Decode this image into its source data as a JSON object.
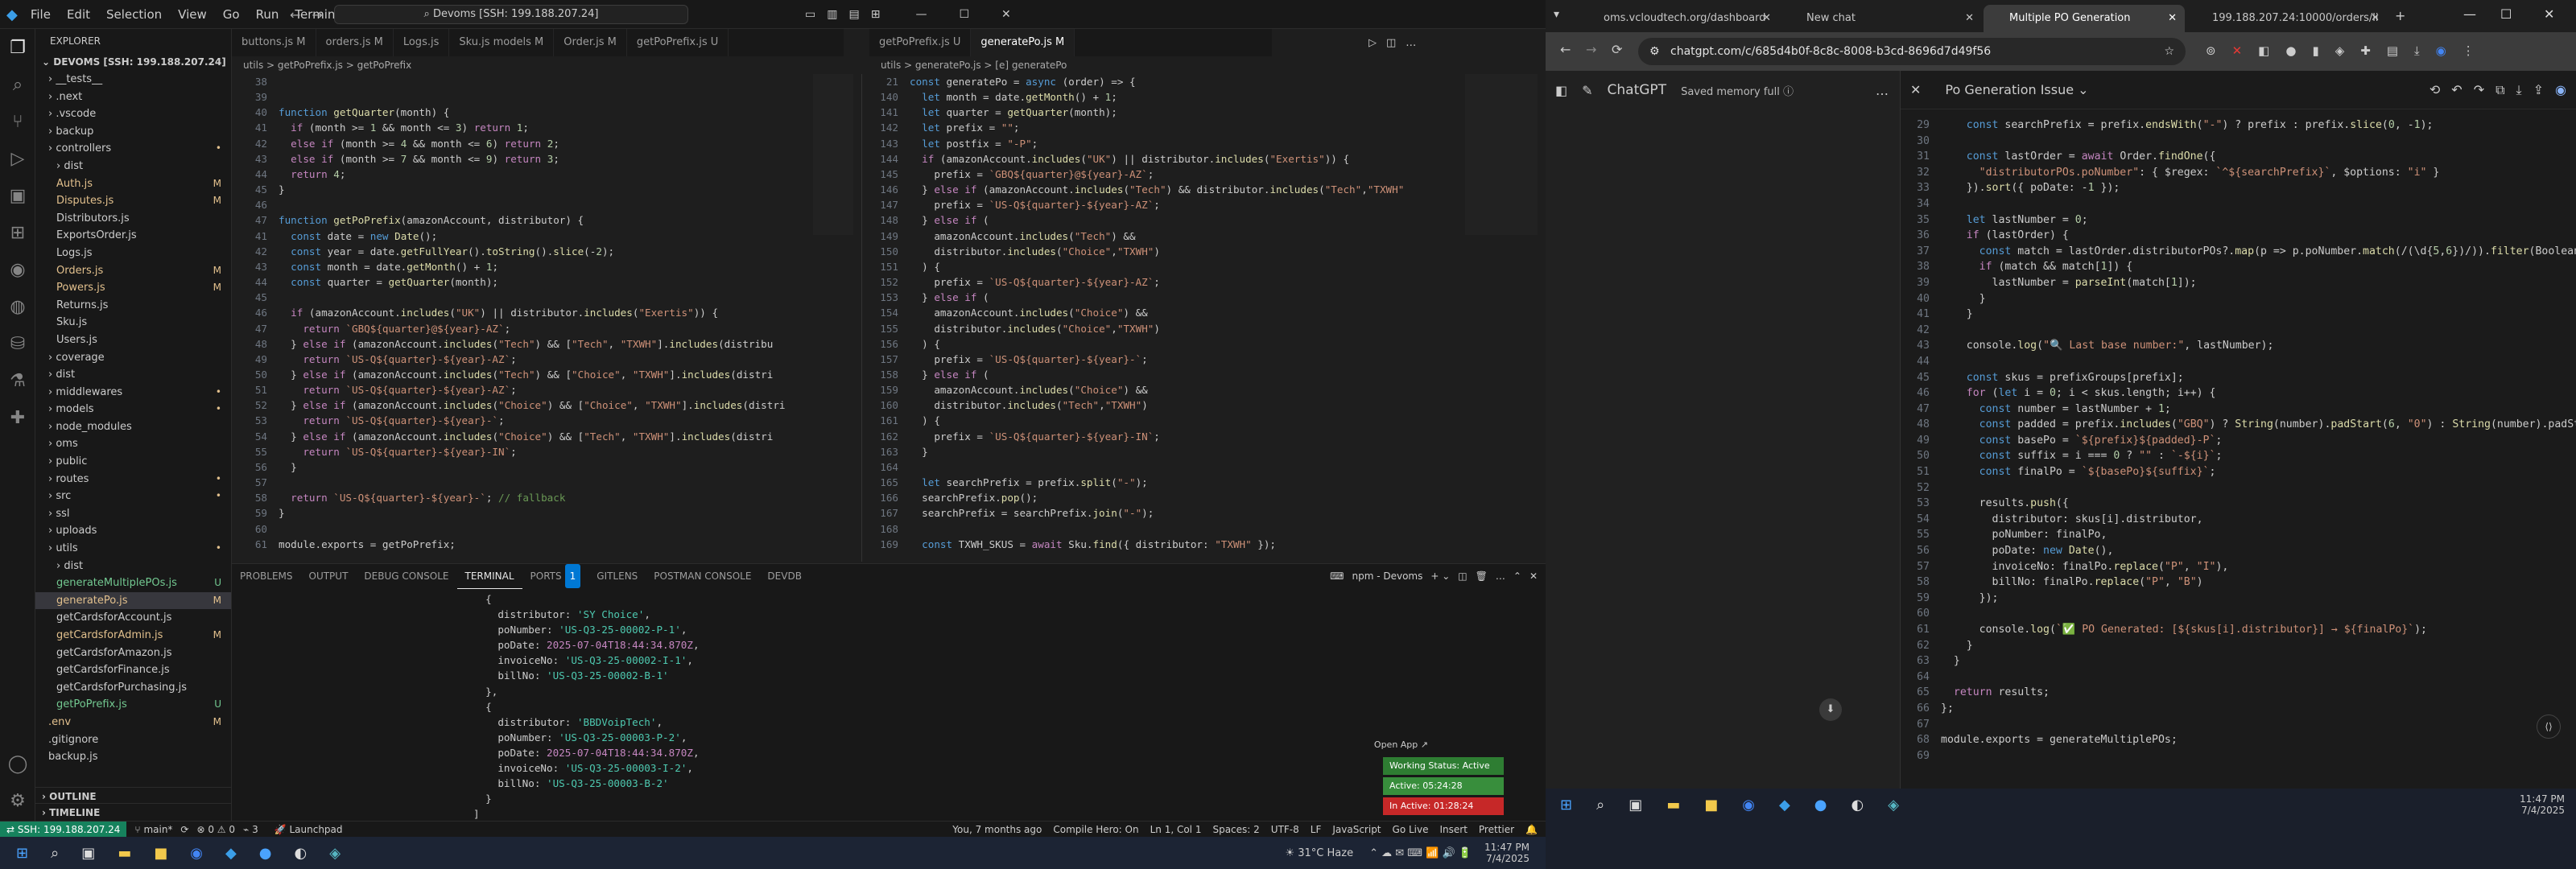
{
  "vscode": {
    "menu": [
      "File",
      "Edit",
      "Selection",
      "View",
      "Go",
      "Run",
      "Terminal",
      "Help"
    ],
    "search": "Devoms [SSH: 199.188.207.24]",
    "explorer_title": "EXPLORER",
    "root": "DEVOMS [SSH: 199.188.207.24]",
    "tree": [
      {
        "n": "__tests__",
        "i": 1,
        "s": ""
      },
      {
        "n": ".next",
        "i": 1,
        "s": ""
      },
      {
        "n": ".vscode",
        "i": 1,
        "s": ""
      },
      {
        "n": "backup",
        "i": 1,
        "s": ""
      },
      {
        "n": "controllers",
        "i": 1,
        "s": "•"
      },
      {
        "n": "dist",
        "i": 2,
        "s": ""
      },
      {
        "n": "Auth.js",
        "i": 2,
        "s": "M"
      },
      {
        "n": "Disputes.js",
        "i": 2,
        "s": "M"
      },
      {
        "n": "Distributors.js",
        "i": 2,
        "s": ""
      },
      {
        "n": "ExportsOrder.js",
        "i": 2,
        "s": ""
      },
      {
        "n": "Logs.js",
        "i": 2,
        "s": ""
      },
      {
        "n": "Orders.js",
        "i": 2,
        "s": "M"
      },
      {
        "n": "Powers.js",
        "i": 2,
        "s": "M"
      },
      {
        "n": "Returns.js",
        "i": 2,
        "s": ""
      },
      {
        "n": "Sku.js",
        "i": 2,
        "s": ""
      },
      {
        "n": "Users.js",
        "i": 2,
        "s": ""
      },
      {
        "n": "coverage",
        "i": 1,
        "s": ""
      },
      {
        "n": "dist",
        "i": 1,
        "s": ""
      },
      {
        "n": "middlewares",
        "i": 1,
        "s": "•"
      },
      {
        "n": "models",
        "i": 1,
        "s": "•"
      },
      {
        "n": "node_modules",
        "i": 1,
        "s": ""
      },
      {
        "n": "oms",
        "i": 1,
        "s": ""
      },
      {
        "n": "public",
        "i": 1,
        "s": ""
      },
      {
        "n": "routes",
        "i": 1,
        "s": "•"
      },
      {
        "n": "src",
        "i": 1,
        "s": "•"
      },
      {
        "n": "ssl",
        "i": 1,
        "s": ""
      },
      {
        "n": "uploads",
        "i": 1,
        "s": ""
      },
      {
        "n": "utils",
        "i": 1,
        "s": "•"
      },
      {
        "n": "dist",
        "i": 2,
        "s": ""
      },
      {
        "n": "generateMultiplePOs.js",
        "i": 2,
        "s": "U"
      },
      {
        "n": "generatePo.js",
        "i": 2,
        "s": "M"
      },
      {
        "n": "getCardsforAccount.js",
        "i": 2,
        "s": ""
      },
      {
        "n": "getCardsforAdmin.js",
        "i": 2,
        "s": "M"
      },
      {
        "n": "getCardsforAmazon.js",
        "i": 2,
        "s": ""
      },
      {
        "n": "getCardsforFinance.js",
        "i": 2,
        "s": ""
      },
      {
        "n": "getCardsforPurchasing.js",
        "i": 2,
        "s": ""
      },
      {
        "n": "getPoPrefix.js",
        "i": 2,
        "s": "U"
      },
      {
        "n": ".env",
        "i": 1,
        "s": "M"
      },
      {
        "n": ".gitignore",
        "i": 1,
        "s": ""
      },
      {
        "n": "backup.js",
        "i": 1,
        "s": ""
      }
    ],
    "outline": "OUTLINE",
    "timeline": "TIMELINE",
    "tabs_left": [
      "buttons.js M",
      "orders.js M",
      "Logs.js",
      "Sku.js models M",
      "Order.js M",
      "getPoPrefix.js U"
    ],
    "tabs_right": [
      "getPoPrefix.js U",
      "generatePo.js M"
    ],
    "crumb_left": "utils > getPoPrefix.js > getPoPrefix",
    "crumb_right": "utils > generatePo.js > [e] generatePo",
    "left_code": [
      [
        "38",
        ""
      ],
      [
        "39",
        ""
      ],
      [
        "40",
        "function getQuarter(month) {"
      ],
      [
        "41",
        "  if (month >= 1 && month <= 3) return 1;"
      ],
      [
        "42",
        "  else if (month >= 4 && month <= 6) return 2;"
      ],
      [
        "43",
        "  else if (month >= 7 && month <= 9) return 3;"
      ],
      [
        "44",
        "  return 4;"
      ],
      [
        "45",
        "}"
      ],
      [
        "46",
        ""
      ],
      [
        "47",
        "function getPoPrefix(amazonAccount, distributor) {"
      ],
      [
        "41",
        "  const date = new Date();"
      ],
      [
        "42",
        "  const year = date.getFullYear().toString().slice(-2);"
      ],
      [
        "43",
        "  const month = date.getMonth() + 1;"
      ],
      [
        "44",
        "  const quarter = getQuarter(month);"
      ],
      [
        "45",
        ""
      ],
      [
        "46",
        "  if (amazonAccount.includes(\"UK\") || distributor.includes(\"Exertis\")) {"
      ],
      [
        "47",
        "    return `GBQ${quarter}@${year}-AZ`;"
      ],
      [
        "48",
        "  } else if (amazonAccount.includes(\"Tech\") && [\"Tech\", \"TXWH\"].includes(distribu"
      ],
      [
        "49",
        "    return `US-Q${quarter}-${year}-AZ`;"
      ],
      [
        "50",
        "  } else if (amazonAccount.includes(\"Tech\") && [\"Choice\", \"TXWH\"].includes(distri"
      ],
      [
        "51",
        "    return `US-Q${quarter}-${year}-AZ`;"
      ],
      [
        "52",
        "  } else if (amazonAccount.includes(\"Choice\") && [\"Choice\", \"TXWH\"].includes(distri"
      ],
      [
        "53",
        "    return `US-Q${quarter}-${year}-`;"
      ],
      [
        "54",
        "  } else if (amazonAccount.includes(\"Choice\") && [\"Tech\", \"TXWH\"].includes(distri"
      ],
      [
        "55",
        "    return `US-Q${quarter}-${year}-IN`;"
      ],
      [
        "56",
        "  }"
      ],
      [
        "57",
        ""
      ],
      [
        "58",
        "  return `US-Q${quarter}-${year}-`; // fallback"
      ],
      [
        "59",
        "}"
      ],
      [
        "60",
        ""
      ],
      [
        "61",
        "module.exports = getPoPrefix;"
      ]
    ],
    "right_code": [
      [
        "21",
        "const generatePo = async (order) => {"
      ],
      [
        "140",
        "  let month = date.getMonth() + 1;"
      ],
      [
        "141",
        "  let quarter = getQuarter(month);"
      ],
      [
        "142",
        "  let prefix = \"\";"
      ],
      [
        "143",
        "  let postfix = \"-P\";"
      ],
      [
        "144",
        "  if (amazonAccount.includes(\"UK\") || distributor.includes(\"Exertis\")) {"
      ],
      [
        "145",
        "    prefix = `GBQ${quarter}@${year}-AZ`;"
      ],
      [
        "146",
        "  } else if (amazonAccount.includes(\"Tech\") && distributor.includes(\"Tech\",\"TXWH\""
      ],
      [
        "147",
        "    prefix = `US-Q${quarter}-${year}-AZ`;"
      ],
      [
        "148",
        "  } else if ("
      ],
      [
        "149",
        "    amazonAccount.includes(\"Tech\") &&"
      ],
      [
        "150",
        "    distributor.includes(\"Choice\",\"TXWH\")"
      ],
      [
        "151",
        "  ) {"
      ],
      [
        "152",
        "    prefix = `US-Q${quarter}-${year}-AZ`;"
      ],
      [
        "153",
        "  } else if ("
      ],
      [
        "154",
        "    amazonAccount.includes(\"Choice\") &&"
      ],
      [
        "155",
        "    distributor.includes(\"Choice\",\"TXWH\")"
      ],
      [
        "156",
        "  ) {"
      ],
      [
        "157",
        "    prefix = `US-Q${quarter}-${year}-`;"
      ],
      [
        "158",
        "  } else if ("
      ],
      [
        "159",
        "    amazonAccount.includes(\"Choice\") &&"
      ],
      [
        "160",
        "    distributor.includes(\"Tech\",\"TXWH\")"
      ],
      [
        "161",
        "  ) {"
      ],
      [
        "162",
        "    prefix = `US-Q${quarter}-${year}-IN`;"
      ],
      [
        "163",
        "  }"
      ],
      [
        "164",
        ""
      ],
      [
        "165",
        "  let searchPrefix = prefix.split(\"-\");"
      ],
      [
        "166",
        "  searchPrefix.pop();"
      ],
      [
        "167",
        "  searchPrefix = searchPrefix.join(\"-\");"
      ],
      [
        "168",
        ""
      ],
      [
        "169",
        "  const TXWH_SKUS = await Sku.find({ distributor: \"TXWH\" });"
      ]
    ],
    "panel_tabs": [
      "PROBLEMS",
      "OUTPUT",
      "DEBUG CONSOLE",
      "TERMINAL",
      "PORTS",
      "GITLENS",
      "POSTMAN CONSOLE",
      "DEVDB"
    ],
    "ports_count": "1",
    "terminal_name": "npm - Devoms",
    "terminal": [
      "  {",
      "    distributor: 'SY Choice',",
      "    poNumber: 'US-Q3-25-00002-P-1',",
      "    poDate: 2025-07-04T18:44:34.870Z,",
      "    invoiceNo: 'US-Q3-25-00002-I-1',",
      "    billNo: 'US-Q3-25-00002-B-1'",
      "  },",
      "  {",
      "    distributor: 'BBDVoipTech',",
      "    poNumber: 'US-Q3-25-00003-P-2',",
      "    poDate: 2025-07-04T18:44:34.870Z,",
      "    invoiceNo: 'US-Q3-25-00003-I-2',",
      "    billNo: 'US-Q3-25-00003-B-2'",
      "  }",
      "]",
      "▯"
    ],
    "open_app": "Open App ↗",
    "working_status": "Working Status: Active",
    "active_time": "Active: 05:24:28",
    "inactive_time": "In Active: 01:28:24",
    "status": {
      "ssh": "SSH: 199.188.207.24",
      "branch": "main*",
      "errors": "⊗ 0 ⚠ 0",
      "ports": "3",
      "blame": "You, 7 months ago",
      "hero": "Compile Hero: On",
      "pos": "Ln 1, Col 1",
      "spaces": "Spaces: 2",
      "enc": "UTF-8",
      "eol": "LF",
      "lang": "JavaScript",
      "golive": "Go Live",
      "insert": "Insert",
      "prettier": "Prettier",
      "launch": "Launchpad"
    },
    "tray_left": {
      "weather": "31°C Haze",
      "time": "11:47 PM",
      "date": "7/4/2025"
    }
  },
  "chrome": {
    "tabs": [
      "oms.vcloudtech.org/dashboard",
      "New chat",
      "Multiple PO Generation",
      "199.188.207.24:10000/orders/li"
    ],
    "url": "chatgpt.com/c/685d4b0f-8c8c-8008-b3cd-8696d7d49f56",
    "brand": "ChatGPT",
    "memory": "Saved memory full",
    "canvas_title": "Po Generation Issue",
    "code": [
      [
        "29",
        "    const searchPrefix = prefix.endsWith(\"-\") ? prefix : prefix.slice(0, -1);"
      ],
      [
        "30",
        ""
      ],
      [
        "31",
        "    const lastOrder = await Order.findOne({"
      ],
      [
        "32",
        "      \"distributorPOs.poNumber\": { $regex: `^${searchPrefix}`, $options: \"i\" }"
      ],
      [
        "33",
        "    }).sort({ poDate: -1 });"
      ],
      [
        "34",
        ""
      ],
      [
        "35",
        "    let lastNumber = 0;"
      ],
      [
        "36",
        "    if (lastOrder) {"
      ],
      [
        "37",
        "      const match = lastOrder.distributorPOs?.map(p => p.poNumber.match(/(\\d{5,6})/)).filter(Boolean).p"
      ],
      [
        "38",
        "      if (match && match[1]) {"
      ],
      [
        "39",
        "        lastNumber = parseInt(match[1]);"
      ],
      [
        "40",
        "      }"
      ],
      [
        "41",
        "    }"
      ],
      [
        "42",
        ""
      ],
      [
        "43",
        "    console.log(\"🔍 Last base number:\", lastNumber);"
      ],
      [
        "44",
        ""
      ],
      [
        "45",
        "    const skus = prefixGroups[prefix];"
      ],
      [
        "46",
        "    for (let i = 0; i < skus.length; i++) {"
      ],
      [
        "47",
        "      const number = lastNumber + 1;"
      ],
      [
        "48",
        "      const padded = prefix.includes(\"GBQ\") ? String(number).padStart(6, \"0\") : String(number).padStart"
      ],
      [
        "49",
        "      const basePo = `${prefix}${padded}-P`;"
      ],
      [
        "50",
        "      const suffix = i === 0 ? \"\" : `-${i}`;"
      ],
      [
        "51",
        "      const finalPo = `${basePo}${suffix}`;"
      ],
      [
        "52",
        ""
      ],
      [
        "53",
        "      results.push({"
      ],
      [
        "54",
        "        distributor: skus[i].distributor,"
      ],
      [
        "55",
        "        poNumber: finalPo,"
      ],
      [
        "56",
        "        poDate: new Date(),"
      ],
      [
        "57",
        "        invoiceNo: finalPo.replace(\"P\", \"I\"),"
      ],
      [
        "58",
        "        billNo: finalPo.replace(\"P\", \"B\")"
      ],
      [
        "59",
        "      });"
      ],
      [
        "60",
        ""
      ],
      [
        "61",
        "      console.log(`✅ PO Generated: [${skus[i].distributor}] → ${finalPo}`);"
      ],
      [
        "62",
        "    }"
      ],
      [
        "63",
        "  }"
      ],
      [
        "64",
        ""
      ],
      [
        "65",
        "  return results;"
      ],
      [
        "66",
        "};"
      ],
      [
        "67",
        ""
      ],
      [
        "68",
        "module.exports = generateMultiplePOs;"
      ],
      [
        "69",
        ""
      ]
    ],
    "tray": {
      "time": "11:47 PM",
      "date": "7/4/2025"
    }
  }
}
